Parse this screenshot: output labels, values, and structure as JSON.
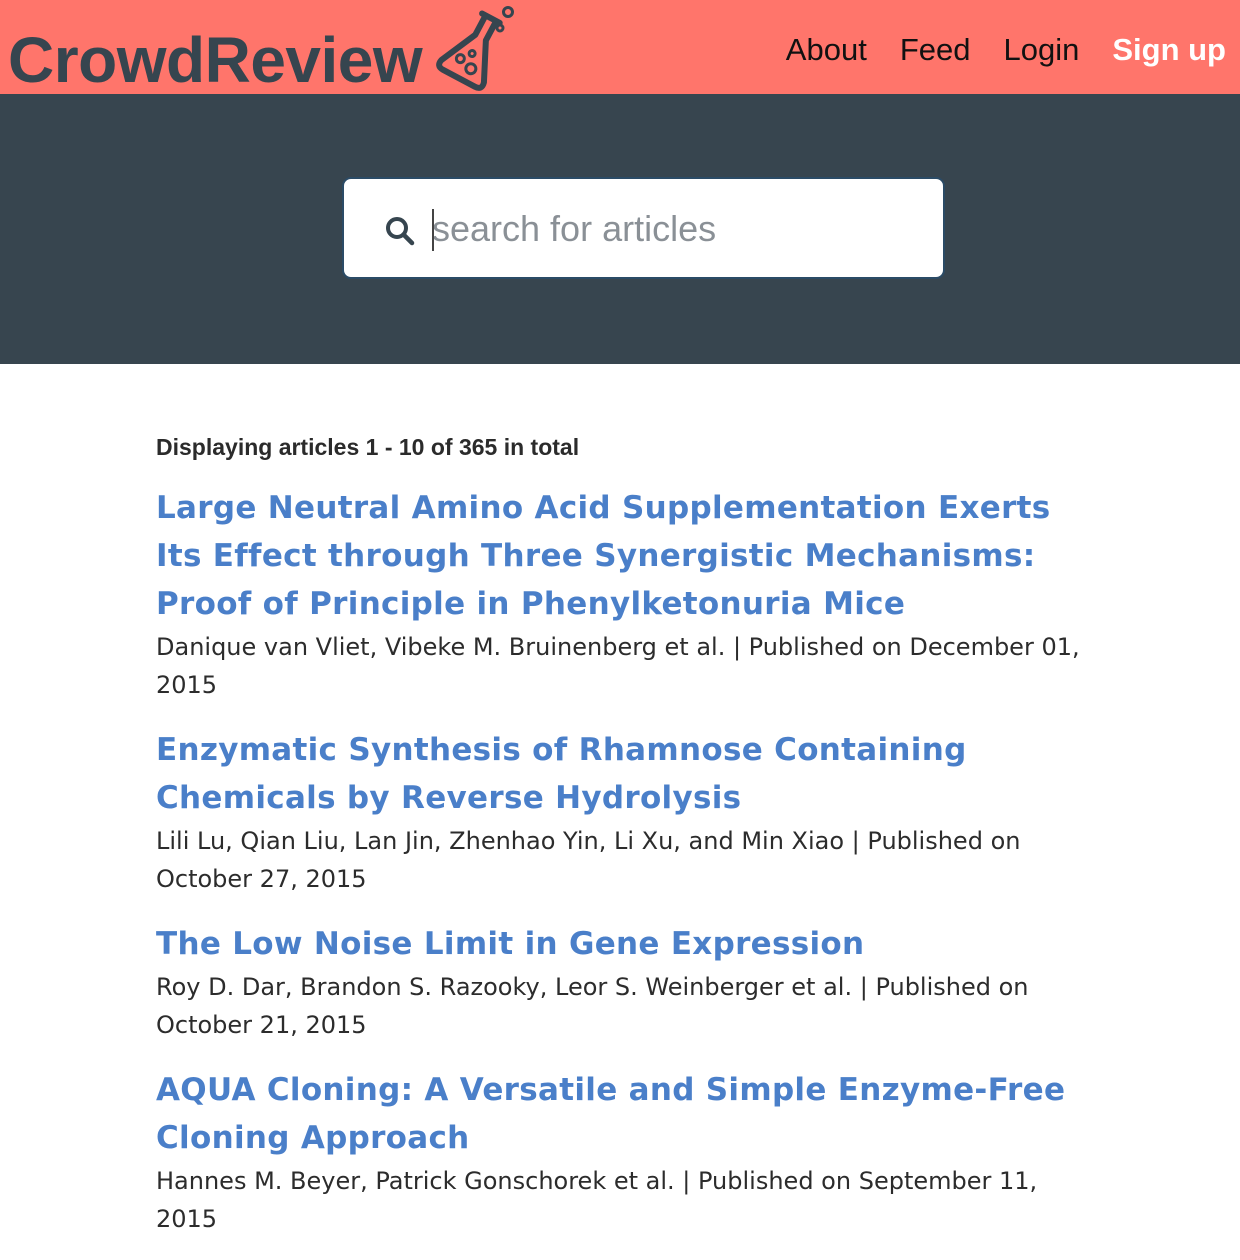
{
  "navbar": {
    "brand": "CrowdReview",
    "brand_icon": "flask-icon",
    "links": {
      "about": "About",
      "feed": "Feed",
      "login": "Login",
      "signup": "Sign up"
    },
    "colors": {
      "background": "#ff756b",
      "brand_text": "#36454f",
      "signup_text": "#ffffff"
    }
  },
  "hero": {
    "background": "#37454f",
    "search": {
      "icon": "search-icon",
      "placeholder": "search for articles",
      "value": ""
    }
  },
  "results": {
    "summary": "Displaying articles 1 - 10 of 365 in total",
    "link_color": "#4a7fc9",
    "articles": [
      {
        "title": "Large Neutral Amino Acid Supplementation Exerts Its Effect through Three Synergistic Mechanisms: Proof of Principle in Phenylketonuria Mice",
        "meta": "Danique van Vliet, Vibeke M. Bruinenberg et al. | Published on December 01, 2015"
      },
      {
        "title": "Enzymatic Synthesis of Rhamnose Containing Chemicals by Reverse Hydrolysis",
        "meta": "Lili Lu, Qian Liu, Lan Jin, Zhenhao Yin, Li Xu, and Min Xiao | Published on October 27, 2015"
      },
      {
        "title": "The Low Noise Limit in Gene Expression",
        "meta": "Roy D. Dar, Brandon S. Razooky, Leor S. Weinberger et al. | Published on October 21, 2015"
      },
      {
        "title": "AQUA Cloning: A Versatile and Simple Enzyme-Free Cloning Approach",
        "meta": "Hannes M. Beyer, Patrick Gonschorek et al. | Published on September 11, 2015"
      }
    ]
  }
}
